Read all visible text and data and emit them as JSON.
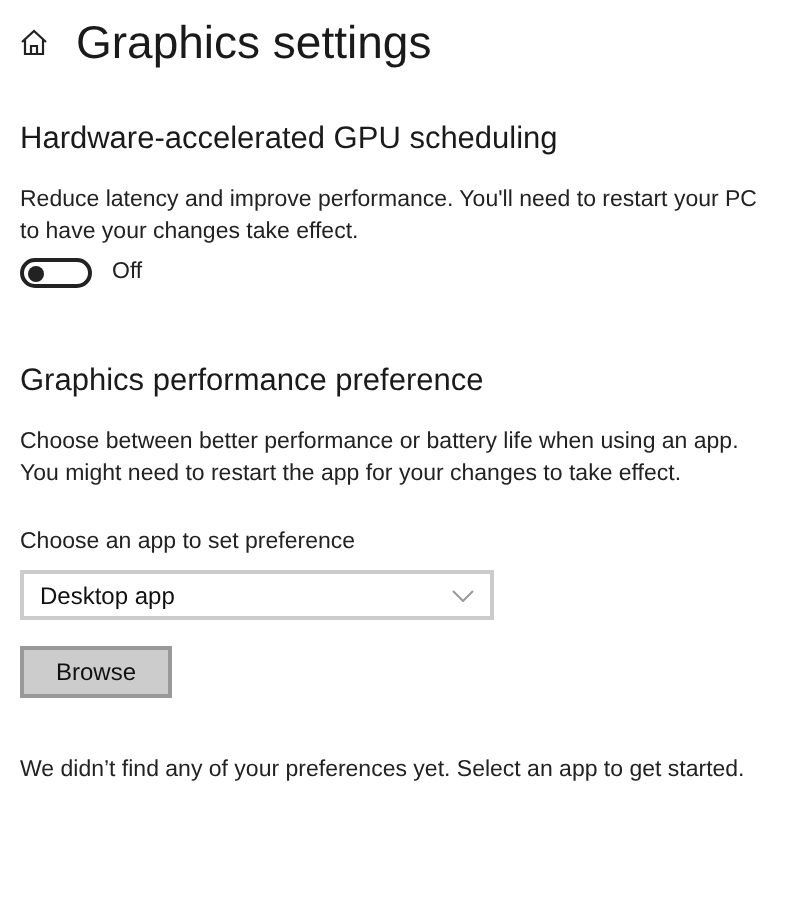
{
  "page": {
    "title": "Graphics settings"
  },
  "gpu_scheduling": {
    "heading": "Hardware-accelerated GPU scheduling",
    "description": "Reduce latency and improve performance. You'll need to restart your PC to have your changes take effect.",
    "toggle": {
      "on": false,
      "label": "Off"
    }
  },
  "performance_preference": {
    "heading": "Graphics performance preference",
    "description": "Choose between better performance or battery life when using an app. You might need to restart the app for your changes to take effect.",
    "dropdown": {
      "label": "Choose an app to set preference",
      "value": "Desktop app"
    },
    "browse_button": "Browse",
    "empty_message": "We didn’t find any of your preferences yet. Select an app to get started."
  }
}
